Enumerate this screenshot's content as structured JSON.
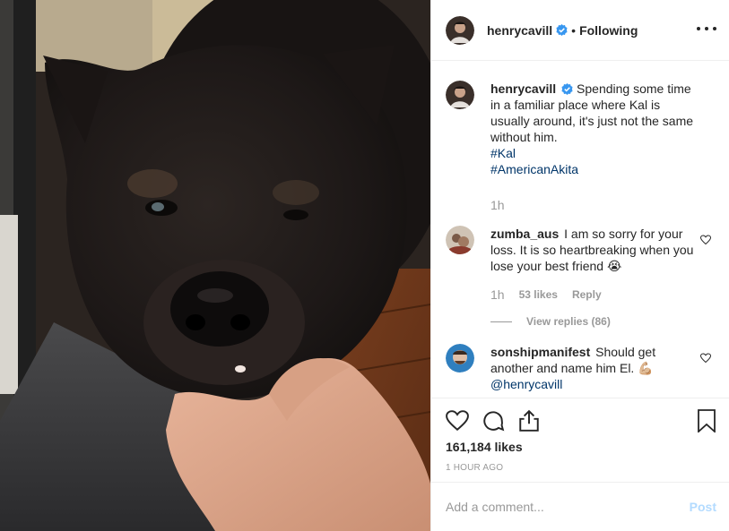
{
  "header": {
    "username": "henrycavill",
    "separator": "•",
    "follow_status": "Following"
  },
  "caption": {
    "username": "henrycavill",
    "text": "Spending some time in a familiar place where Kal is usually around, it's just not the same without him.",
    "hashtags": [
      "#Kal",
      "#AmericanAkita"
    ],
    "time": "1h"
  },
  "comments": [
    {
      "username": "zumba_aus",
      "text": "I am so sorry for your loss. It is so heartbreaking when you lose your best friend 😭",
      "time": "1h",
      "likes": "53 likes",
      "reply_label": "Reply",
      "view_replies": "View replies (86)"
    },
    {
      "username": "sonshipmanifest",
      "text": "Should get another and name him El. 💪🏼",
      "mention": "@henrycavill"
    }
  ],
  "actions": {
    "icons": [
      "heart-icon",
      "comment-icon",
      "share-icon",
      "bookmark-icon"
    ],
    "like_count": "161,184 likes",
    "date": "1 HOUR AGO"
  },
  "add_comment": {
    "placeholder": "Add a comment...",
    "post_label": "Post"
  },
  "colors": {
    "text": "#262626",
    "muted": "#999999",
    "link": "#003569",
    "verified": "#3897f0",
    "post_disabled": "#b3dbff"
  }
}
